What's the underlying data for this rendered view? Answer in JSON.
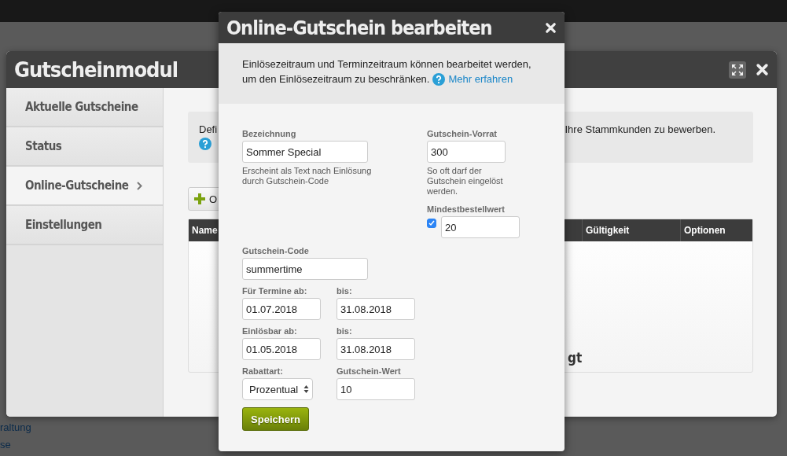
{
  "background_page": {
    "links": [
      "raltung",
      "se"
    ]
  },
  "window": {
    "title": "Gutscheinmodul",
    "sidebar": {
      "items": [
        {
          "label": "Aktuelle Gutscheine",
          "selected": false
        },
        {
          "label": "Status",
          "selected": false
        },
        {
          "label": "Online-Gutscheine",
          "selected": true
        },
        {
          "label": "Einstellungen",
          "selected": false
        }
      ]
    },
    "info": {
      "text_start": "Defi",
      "text_end": "Ihre Stammkunden zu bewerben."
    },
    "add_button": {
      "label": "O"
    },
    "table": {
      "columns": [
        "Name",
        "Gültigkeit",
        "Optionen"
      ],
      "empty_message": "gt"
    }
  },
  "dialog": {
    "title": "Online-Gutschein bearbeiten",
    "intro_lines": [
      "Einlösezeitraum und Terminzeitraum können bearbeitet werden,",
      "um den Einlösezeitraum zu beschränken."
    ],
    "link": "Mehr erfahren",
    "name": {
      "label": "Bezeichnung",
      "value": "Sommer Special",
      "hint": "Erscheint als Text nach Einlösung durch Gutschein-Code"
    },
    "stock": {
      "label": "Gutschein-Vorrat",
      "value": "300",
      "hint": "So oft darf der Gutschein eingelöst werden."
    },
    "min_order": {
      "label": "Mindestbestellwert",
      "checked": true,
      "value": "20"
    },
    "code": {
      "label": "Gutschein-Code",
      "value": "summertime"
    },
    "date_rows": [
      {
        "from": {
          "label": "Für Termine ab:",
          "value": "01.07.2018"
        },
        "to": {
          "label": "bis:",
          "value": "31.08.2018"
        }
      },
      {
        "from": {
          "label": "Einlösbar ab:",
          "value": "01.05.2018"
        },
        "to": {
          "label": "bis:",
          "value": "31.08.2018"
        }
      }
    ],
    "discount_type": {
      "label": "Rabattart:",
      "value": "Prozentual"
    },
    "voucher_value": {
      "label": "Gutschein-Wert",
      "value": "10"
    },
    "save_button": "Speichern"
  }
}
